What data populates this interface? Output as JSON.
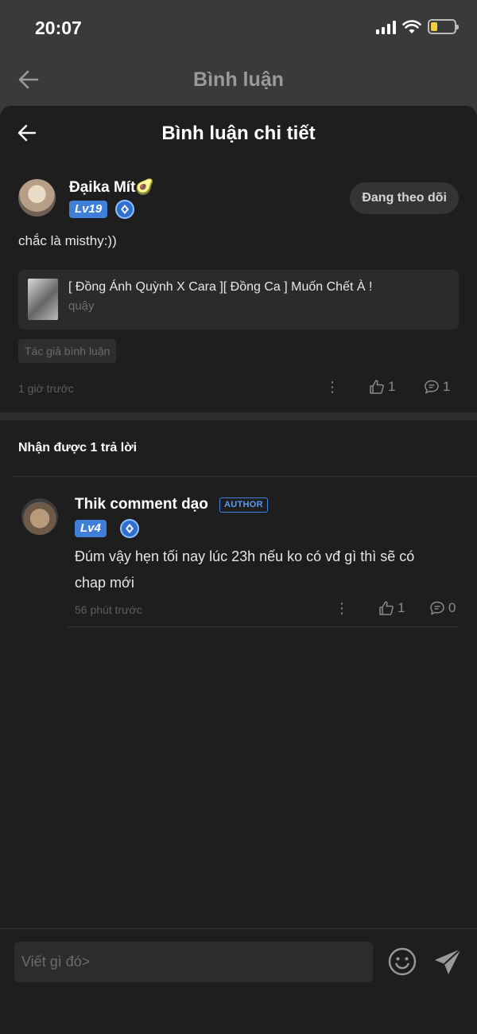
{
  "status": {
    "time": "20:07"
  },
  "background_header": {
    "title": "Bình luận"
  },
  "sheet": {
    "title": "Bình luận chi tiết"
  },
  "comment": {
    "user_name": "Đạika Mít🥑",
    "level": "Lv19",
    "follow_label": "Đang theo dõi",
    "text": "chắc là misthy:))",
    "story_title": "[ Đồng Ánh Quỳnh X Cara ][ Đồng Ca ] Muốn Chết À !",
    "story_subtitle": "quậy",
    "tag": "Tác giả bình luận",
    "time": "1 giờ trước",
    "likes": "1",
    "replies": "1"
  },
  "replies_header": "Nhận được 1 trả lời",
  "reply": {
    "user_name": "Thik comment dạo",
    "author_badge": "AUTHOR",
    "level": "Lv4",
    "text": "Đúm vậy hẹn tối nay lúc 23h nếu ko có vđ gì thì sẽ có chap mới",
    "time": "56 phút trước",
    "likes": "1",
    "replies": "0"
  },
  "input": {
    "placeholder": "Viết gì đó>"
  },
  "colors": {
    "level_badge": "#3f7fd8",
    "author_badge": "#3f82e0",
    "sheet_bg": "#1e1e1f"
  }
}
